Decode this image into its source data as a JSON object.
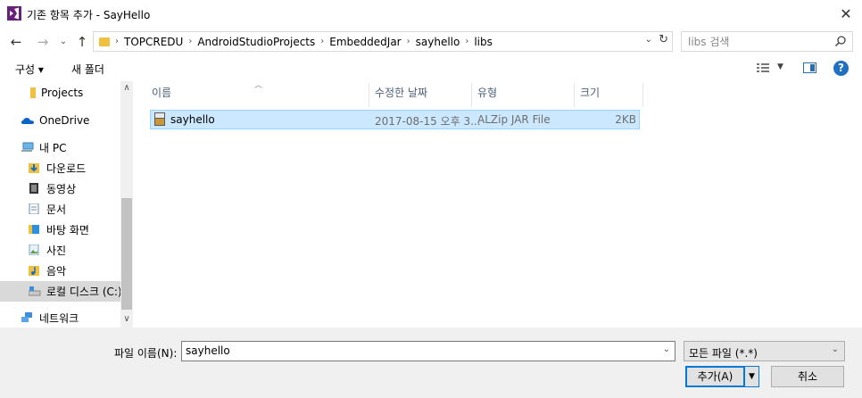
{
  "window": {
    "title": "기존 항목 추가 - SayHello",
    "close_glyph": "✕"
  },
  "addressbar": {
    "crumbs": [
      "TOPCREDU",
      "AndroidStudioProjects",
      "EmbeddedJar",
      "sayhello",
      "libs"
    ],
    "separator": "›"
  },
  "search": {
    "placeholder": "libs 검색"
  },
  "toolbar": {
    "organize_label": "구성 ▾",
    "new_folder_label": "새 폴더",
    "help_label": "?"
  },
  "navpane": {
    "items": [
      {
        "label": "Projects",
        "icon": "folder-icon"
      },
      {
        "label": "OneDrive",
        "icon": "cloud-icon"
      },
      {
        "label": "내 PC",
        "icon": "computer-icon"
      },
      {
        "label": "다운로드",
        "icon": "downloads-icon"
      },
      {
        "label": "동영상",
        "icon": "videos-icon"
      },
      {
        "label": "문서",
        "icon": "documents-icon"
      },
      {
        "label": "바탕 화면",
        "icon": "desktop-icon"
      },
      {
        "label": "사진",
        "icon": "pictures-icon"
      },
      {
        "label": "음악",
        "icon": "music-icon"
      },
      {
        "label": "로컬 디스크 (C:)",
        "icon": "drive-icon"
      },
      {
        "label": "네트워크",
        "icon": "network-icon"
      }
    ],
    "selected": "로컬 디스크 (C:)"
  },
  "filelist": {
    "columns": [
      "이름",
      "수정한 날짜",
      "유형",
      "크기"
    ],
    "rows": [
      {
        "name": "sayhello",
        "date": "2017-08-15 오후 3...",
        "type": "ALZip JAR File",
        "size": "2KB"
      }
    ]
  },
  "bottom": {
    "filename_label": "파일 이름(N):",
    "filename_value": "sayhello",
    "filter_value": "모든 파일 (*.*)",
    "add_label": "추가(A)",
    "cancel_label": "취소"
  },
  "colors": {
    "selection_bg": "#cce8ff",
    "selection_border": "#99d1ff",
    "accent": "#0078d7",
    "help_blue": "#1f6fc5",
    "column_header": "#4c607a"
  }
}
